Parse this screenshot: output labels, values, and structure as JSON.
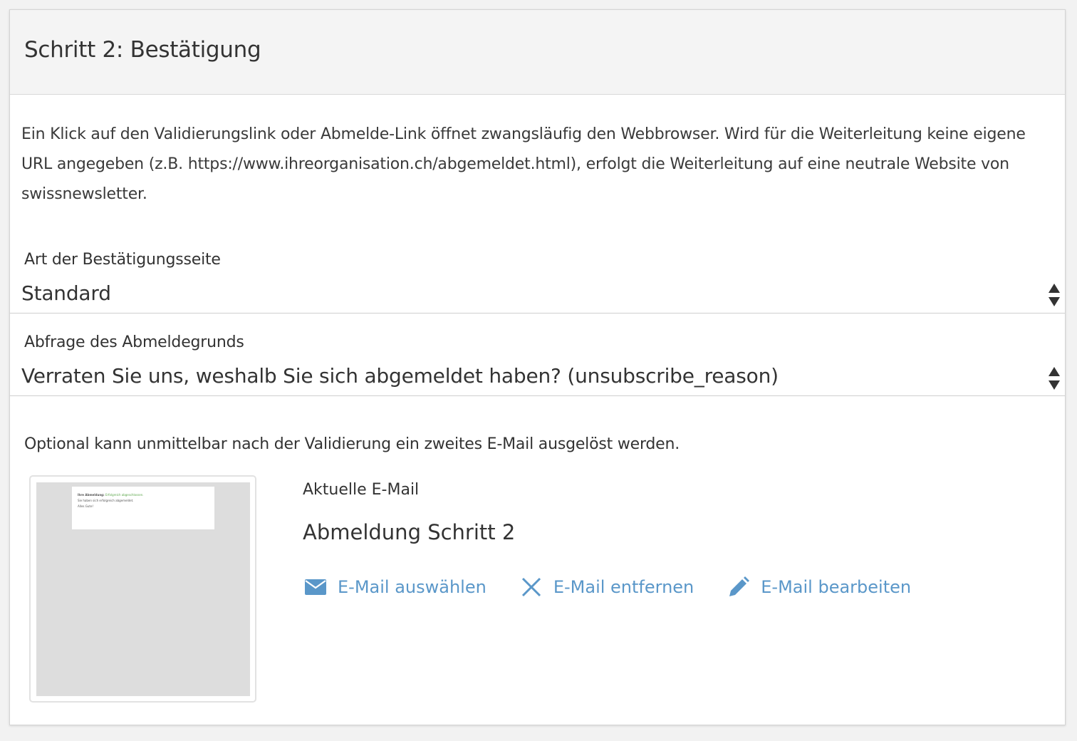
{
  "header": {
    "title": "Schritt 2: Bestätigung"
  },
  "intro": {
    "text": "Ein Klick auf den Validierungslink oder Abmelde-Link öffnet zwangsläufig den Webbrowser. Wird für die Weiterleitung keine eigene URL angegeben (z.B. https://www.ihreorganisation.ch/abgemeldet.html), erfolgt die Weiterleitung auf eine neutrale Website von swissnewsletter."
  },
  "confirmation_page": {
    "label": "Art der Bestätigungsseite",
    "value": "Standard"
  },
  "unsubscribe_reason": {
    "label": "Abfrage des Abmeldegrunds",
    "value": "Verraten Sie uns, weshalb Sie sich abgemeldet haben? (unsubscribe_reason)"
  },
  "optional": {
    "text": "Optional kann unmittelbar nach der Validierung ein zweites E-Mail ausgelöst werden."
  },
  "email": {
    "current_label": "Aktuelle E-Mail",
    "current_name": "Abmeldung Schritt 2",
    "preview": {
      "line1_prefix": "Ihre Abmeldung:",
      "line1_status": "Erfolgreich abgeschlossen.",
      "line2": "Sie haben sich erfolgreich abgemeldet.",
      "line3": "Alles Gute!"
    },
    "actions": {
      "select": "E-Mail auswählen",
      "remove": "E-Mail entfernen",
      "edit": "E-Mail bearbeiten"
    }
  },
  "colors": {
    "link": "#5a97c9",
    "header_bg": "#f4f4f4",
    "text": "#333333"
  },
  "icons": {
    "select": "envelope-icon",
    "remove": "close-x-icon",
    "edit": "pencil-icon",
    "dropdown": "sort-arrows-icon"
  }
}
